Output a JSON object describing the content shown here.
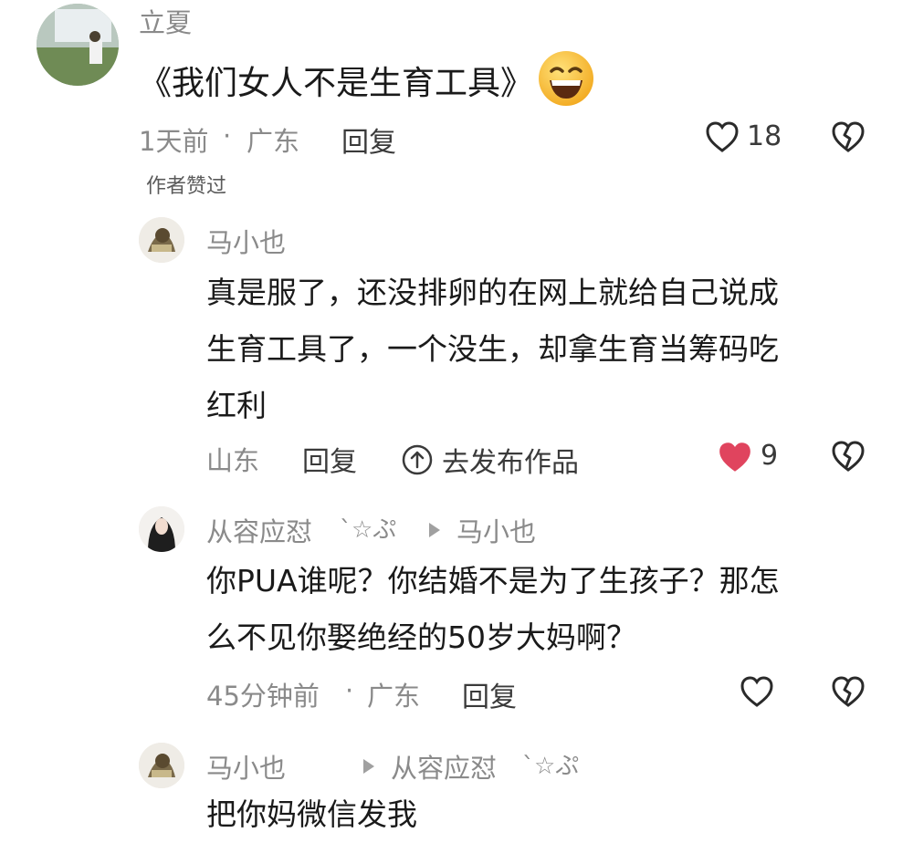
{
  "comment": {
    "author": "立夏",
    "text": "《我们女人不是生育工具》",
    "emoji_icon": "grinning-face-emoji",
    "time": "1天前",
    "separator": "·",
    "location": "广东",
    "reply_label": "回复",
    "like_count": "18",
    "badge": "作者赞过"
  },
  "replies": [
    {
      "author": "马小也",
      "text_lines": [
        "真是服了，还没排卵的在网上就给自己说成",
        "生育工具了，一个没生，却拿生育当筹码吃",
        "红利"
      ],
      "location": "山东",
      "reply_label": "回复",
      "publish_label": "去发布作品",
      "like_count": "9",
      "liked": true
    },
    {
      "author": "从容应怼",
      "author_deco": "ˋ☆ぷ",
      "reply_to": "马小也",
      "text_lines": [
        "你PUA谁呢？你结婚不是为了生孩子？那怎",
        "么不见你娶绝经的50岁大妈啊？"
      ],
      "time": "45分钟前",
      "separator": "·",
      "location": "广东",
      "reply_label": "回复"
    },
    {
      "author": "马小也",
      "reply_to": "从容应怼",
      "reply_to_deco": "ˋ☆ぷ",
      "text_lines": [
        "把你妈微信发我"
      ]
    }
  ],
  "colors": {
    "like_red": "#e0445e",
    "muted": "#8a8a8a",
    "text": "#1a1a1a"
  }
}
